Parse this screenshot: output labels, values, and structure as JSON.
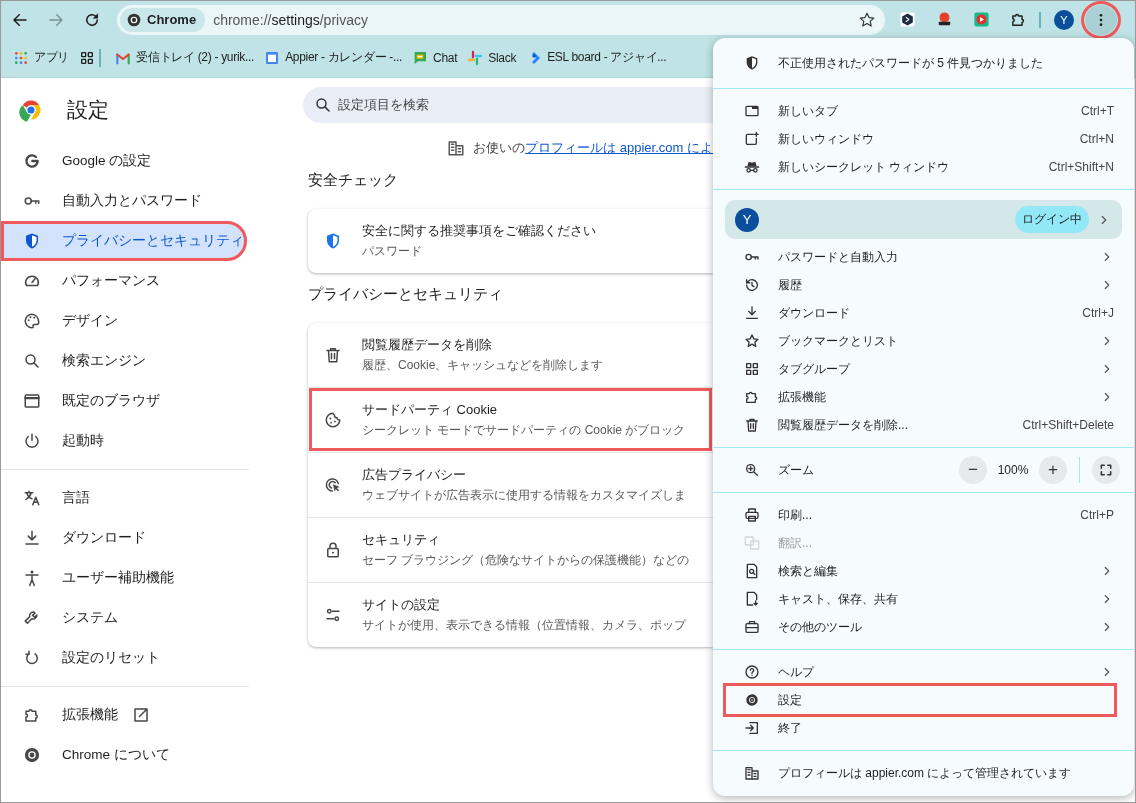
{
  "toolbar": {
    "site_chip": "Chrome",
    "url": [
      {
        "text": "chrome://",
        "kind": "dim"
      },
      {
        "text": "settings",
        "kind": "strong"
      },
      {
        "text": "/privacy",
        "kind": "dim"
      }
    ],
    "avatar": "Y",
    "menu_button": {
      "highlighted": true
    }
  },
  "bookmarks": [
    {
      "kind": "apps",
      "label": "アプリ"
    },
    {
      "kind": "groups"
    },
    {
      "kind": "mail",
      "label": "受信トレイ (2) - yurik..."
    },
    {
      "kind": "calendar",
      "label": "Appier - カレンダー -..."
    },
    {
      "kind": "chat",
      "label": "Chat"
    },
    {
      "kind": "slack",
      "label": "Slack"
    },
    {
      "kind": "board",
      "label": "ESL board - アジャイ..."
    }
  ],
  "sidebar": {
    "title": "設定",
    "groups": [
      [
        {
          "kind": "google",
          "label": "Google の設定",
          "selected": false,
          "highlighted": false,
          "external": false
        },
        {
          "kind": "key",
          "label": "自動入力とパスワード",
          "selected": false,
          "highlighted": false,
          "external": false
        },
        {
          "kind": "shield",
          "label": "プライバシーとセキュリティ",
          "selected": true,
          "highlighted": true,
          "external": false
        },
        {
          "kind": "gauge",
          "label": "パフォーマンス",
          "selected": false,
          "highlighted": false,
          "external": false
        },
        {
          "kind": "palette",
          "label": "デザイン",
          "selected": false,
          "highlighted": false,
          "external": false
        },
        {
          "kind": "search",
          "label": "検索エンジン",
          "selected": false,
          "highlighted": false,
          "external": false
        },
        {
          "kind": "browser",
          "label": "既定のブラウザ",
          "selected": false,
          "highlighted": false,
          "external": false
        },
        {
          "kind": "power",
          "label": "起動時",
          "selected": false,
          "highlighted": false,
          "external": false
        }
      ],
      [
        {
          "kind": "language",
          "label": "言語",
          "selected": false,
          "highlighted": false,
          "external": false
        },
        {
          "kind": "download",
          "label": "ダウンロード",
          "selected": false,
          "highlighted": false,
          "external": false
        },
        {
          "kind": "person",
          "label": "ユーザー補助機能",
          "selected": false,
          "highlighted": false,
          "external": false
        },
        {
          "kind": "wrench",
          "label": "システム",
          "selected": false,
          "highlighted": false,
          "external": false
        },
        {
          "kind": "reset",
          "label": "設定のリセット",
          "selected": false,
          "highlighted": false,
          "external": false
        }
      ],
      [
        {
          "kind": "puzzle",
          "label": "拡張機能",
          "selected": false,
          "highlighted": false,
          "external": true
        },
        {
          "kind": "chrome",
          "label": "Chrome について",
          "selected": false,
          "highlighted": false,
          "external": false
        }
      ]
    ]
  },
  "main": {
    "search": {
      "placeholder": "設定項目を検索"
    },
    "managed": {
      "text": "お使いの",
      "link": "プロフィールは appier.com によ"
    },
    "sections": [
      {
        "heading": "安全チェック",
        "rows": [
          {
            "kind": "shield",
            "title": "安全に関する推奨事項をご確認ください",
            "subtitle": "パスワード",
            "highlighted": false
          }
        ]
      },
      {
        "heading": "プライバシーとセキュリティ",
        "rows": [
          {
            "kind": "trash",
            "title": "閲覧履歴データを削除",
            "subtitle": "履歴、Cookie、キャッシュなどを削除します",
            "highlighted": false
          },
          {
            "kind": "cookie",
            "title": "サードパーティ Cookie",
            "subtitle": "シークレット モードでサードパーティの Cookie がブロック",
            "highlighted": true
          },
          {
            "kind": "adclick",
            "title": "広告プライバシー",
            "subtitle": "ウェブサイトが広告表示に使用する情報をカスタマイズしま",
            "highlighted": false
          },
          {
            "kind": "lock",
            "title": "セキュリティ",
            "subtitle": "セーフ ブラウジング（危険なサイトからの保護機能）などの",
            "highlighted": false
          },
          {
            "kind": "tune",
            "title": "サイトの設定",
            "subtitle": "サイトが使用、表示できる情報（位置情報、カメラ、ポップ",
            "highlighted": false
          }
        ]
      }
    ]
  },
  "menu": {
    "sections": [
      [
        {
          "kind": "shield",
          "label": "不正使用されたパスワードが 5 件見つかりました",
          "submenu": false,
          "disabled": false,
          "highlighted": false
        }
      ],
      [
        {
          "kind": "tab",
          "label": "新しいタブ",
          "shortcut": "Ctrl+T",
          "submenu": false,
          "disabled": false,
          "highlighted": false
        },
        {
          "kind": "window",
          "label": "新しいウィンドウ",
          "shortcut": "Ctrl+N",
          "submenu": false,
          "disabled": false,
          "highlighted": false
        },
        {
          "kind": "incognito",
          "label": "新しいシークレット ウィンドウ",
          "shortcut": "Ctrl+Shift+N",
          "submenu": false,
          "disabled": false,
          "highlighted": false
        }
      ],
      [
        {
          "kind": "profile",
          "avatar": "Y",
          "badge": "ログイン中",
          "submenu": true,
          "highlighted": false
        },
        {
          "kind": "key",
          "label": "パスワードと自動入力",
          "submenu": true,
          "disabled": false,
          "highlighted": false
        },
        {
          "kind": "history",
          "label": "履歴",
          "submenu": true,
          "disabled": false,
          "highlighted": false
        },
        {
          "kind": "download",
          "label": "ダウンロード",
          "shortcut": "Ctrl+J",
          "submenu": false,
          "disabled": false,
          "highlighted": false
        },
        {
          "kind": "star",
          "label": "ブックマークとリスト",
          "submenu": true,
          "disabled": false,
          "highlighted": false
        },
        {
          "kind": "grid",
          "label": "タブグループ",
          "submenu": true,
          "disabled": false,
          "highlighted": false
        },
        {
          "kind": "puzzle",
          "label": "拡張機能",
          "submenu": true,
          "disabled": false,
          "highlighted": false
        },
        {
          "kind": "trash",
          "label": "閲覧履歴データを削除...",
          "shortcut": "Ctrl+Shift+Delete",
          "submenu": false,
          "disabled": false,
          "highlighted": false
        }
      ],
      [
        {
          "kind": "zoom",
          "label": "ズーム",
          "zoom_out": "−",
          "level_text": "100%",
          "zoom_in": "+"
        }
      ],
      [
        {
          "kind": "print",
          "label": "印刷...",
          "shortcut": "Ctrl+P",
          "submenu": false,
          "disabled": false,
          "highlighted": false
        },
        {
          "kind": "translate",
          "label": "翻訳...",
          "submenu": false,
          "disabled": true,
          "highlighted": false
        },
        {
          "kind": "find",
          "label": "検索と編集",
          "submenu": true,
          "disabled": false,
          "highlighted": false
        },
        {
          "kind": "cast",
          "label": "キャスト、保存、共有",
          "submenu": true,
          "disabled": false,
          "highlighted": false
        },
        {
          "kind": "toolbox",
          "label": "その他のツール",
          "submenu": true,
          "disabled": false,
          "highlighted": false
        }
      ],
      [
        {
          "kind": "help",
          "label": "ヘルプ",
          "submenu": true,
          "disabled": false,
          "highlighted": false
        },
        {
          "kind": "gear",
          "label": "設定",
          "submenu": false,
          "disabled": false,
          "highlighted": true
        },
        {
          "kind": "exit",
          "label": "終了",
          "submenu": false,
          "disabled": false,
          "highlighted": false
        }
      ],
      [
        {
          "kind": "building",
          "label": "プロフィールは appier.com によって管理されています",
          "submenu": false,
          "disabled": false,
          "highlighted": false
        }
      ]
    ]
  }
}
